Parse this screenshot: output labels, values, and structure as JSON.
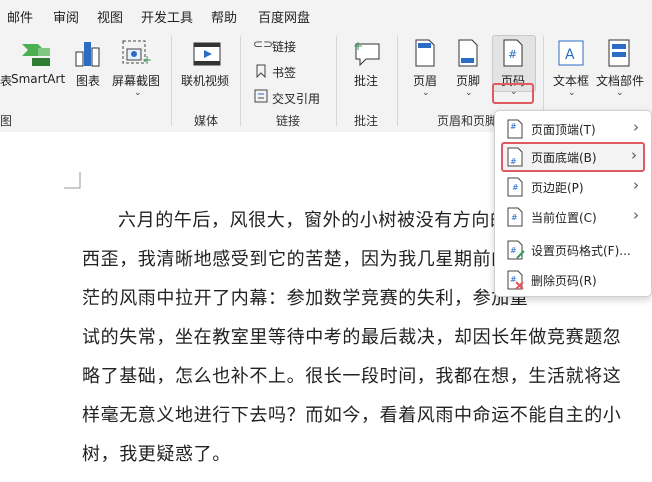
{
  "menubar": {
    "tabs": [
      "邮件",
      "审阅",
      "视图",
      "开发工具",
      "帮助",
      "百度网盘"
    ]
  },
  "ribbon": {
    "buttons": {
      "smartart": "SmartArt",
      "chart": "图表",
      "screenshot": "屏幕截图",
      "online_video": "联机视频",
      "link": "链接",
      "bookmark": "书签",
      "cross_ref": "交叉引用",
      "comment": "批注",
      "header": "页眉",
      "footer": "页脚",
      "page_number": "页码",
      "textbox": "文本框",
      "doc_parts": "文档部件"
    },
    "groups": {
      "illustrations_tail": "图",
      "media": "媒体",
      "links": "链接",
      "comments": "批注",
      "header_footer": "页眉和页脚"
    },
    "left_cut_label": "表"
  },
  "dropdown": {
    "items": [
      {
        "label": "页面顶端(T)",
        "icon": "page-top-icon",
        "submenu": true
      },
      {
        "label": "页面底端(B)",
        "icon": "page-bottom-icon",
        "submenu": true,
        "highlighted": true
      },
      {
        "label": "页边距(P)",
        "icon": "page-margin-icon",
        "submenu": true
      },
      {
        "label": "当前位置(C)",
        "icon": "current-position-icon",
        "submenu": true
      },
      {
        "label": "设置页码格式(F)...",
        "icon": "format-page-number-icon",
        "submenu": false
      },
      {
        "label": "删除页码(R)",
        "icon": "remove-page-number-icon",
        "submenu": false
      }
    ]
  },
  "document": {
    "lines": [
      "六月的午后，风很大，窗外的小树被没有方向的狂",
      "西歪，我清晰地感受到它的苦楚，因为我几星期前的心",
      "茫的风雨中拉开了内幕：参加数学竞赛的失利，参加重",
      "试的失常，坐在教室里等待中考的最后裁决，却因长年做竞赛题忽",
      "略了基础，怎么也补不上。很长一段时间，我都在想，生活就将这",
      "样毫无意义地进行下去吗？而如今，看着风雨中命运不能自主的小",
      "树，我更疑惑了。"
    ]
  },
  "colors": {
    "accent_blue": "#2b6cc4",
    "highlight_red": "#e05a63",
    "icon_green": "#2e9b55"
  }
}
